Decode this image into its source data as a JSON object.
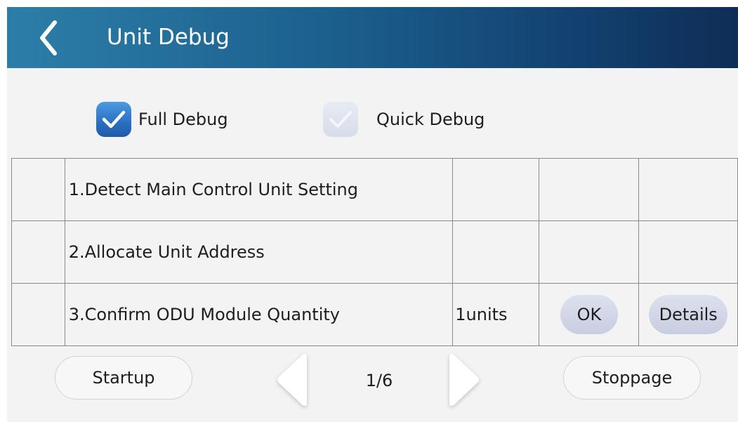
{
  "header": {
    "title": "Unit Debug",
    "back_icon": "chevron-left-icon"
  },
  "modes": {
    "full": {
      "label": "Full Debug",
      "checked": true
    },
    "quick": {
      "label": "Quick Debug",
      "checked": false
    }
  },
  "steps": [
    {
      "label": "1.Detect Main Control Unit Setting",
      "value": "",
      "ok": "",
      "details": ""
    },
    {
      "label": "2.Allocate Unit Address",
      "value": "",
      "ok": "",
      "details": ""
    },
    {
      "label": "3.Confirm ODU Module Quantity",
      "value": "1units",
      "ok": "OK",
      "details": "Details"
    }
  ],
  "footer": {
    "startup_label": "Startup",
    "stoppage_label": "Stoppage",
    "page_indicator": "1/6"
  },
  "colors": {
    "header_start": "#2c7ea8",
    "header_end": "#0f2d56",
    "checkbox_checked": "#2a6fc2",
    "checkbox_unchecked": "#d6dcea"
  }
}
